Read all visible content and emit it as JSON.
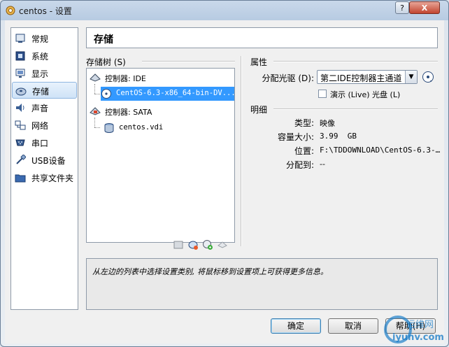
{
  "window": {
    "title": "centos - 设置",
    "help_glyph": "?",
    "close_glyph": "X"
  },
  "nav": {
    "items": [
      {
        "label": "常规",
        "icon": "general-icon"
      },
      {
        "label": "系统",
        "icon": "system-icon"
      },
      {
        "label": "显示",
        "icon": "display-icon"
      },
      {
        "label": "存储",
        "icon": "storage-icon",
        "selected": true
      },
      {
        "label": "声音",
        "icon": "audio-icon"
      },
      {
        "label": "网络",
        "icon": "network-icon"
      },
      {
        "label": "串口",
        "icon": "serial-port-icon"
      },
      {
        "label": "USB设备",
        "icon": "usb-icon"
      },
      {
        "label": "共享文件夹",
        "icon": "shared-folder-icon"
      }
    ]
  },
  "header": {
    "title": "存储"
  },
  "tree": {
    "label": "存储树 (S)",
    "controller_ide": "控制器: IDE",
    "ide_disk": "CentOS-6.3-x86_64-bin-DV...",
    "controller_sata": "控制器: SATA",
    "sata_disk": "centos.vdi"
  },
  "properties": {
    "label": "属性",
    "optical_drive_label": "分配光驱 (D):",
    "optical_drive_value": "第二IDE控制器主通道",
    "live_cd_label": "演示 (Live) 光盘 (L)",
    "live_cd_checked": false
  },
  "details": {
    "label": "明细",
    "type_label": "类型:",
    "type_value": "映像",
    "size_label": "容量大小:",
    "size_value": "3.99  GB",
    "location_label": "位置:",
    "location_value": "F:\\TDDOWNLOAD\\CentOS-6.3-…",
    "attached_label": "分配到:",
    "attached_value": "--"
  },
  "info": {
    "text": "从左边的列表中选择设置类别, 将鼠标移到设置项上可获得更多信息。"
  },
  "buttons": {
    "ok": "确定",
    "cancel": "取消",
    "help": "帮助(H)"
  },
  "watermark": {
    "brand": "运维网",
    "site": "iyunv.com"
  }
}
